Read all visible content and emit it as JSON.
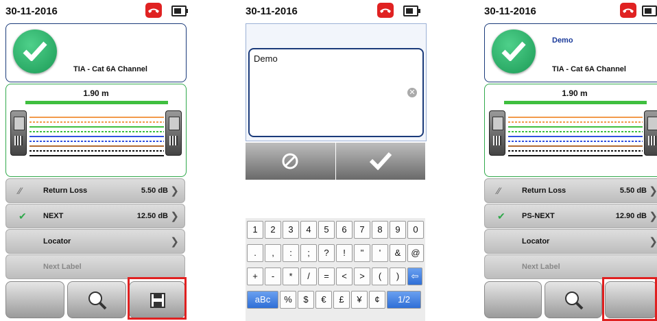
{
  "panel1": {
    "date": "30-11-2016",
    "standard": "TIA - Cat 6A Channel",
    "length": "1.90 m",
    "rows": [
      {
        "name": "Return Loss",
        "value": "5.50 dB"
      },
      {
        "name": "NEXT",
        "value": "12.50 dB"
      },
      {
        "name": "Locator",
        "value": ""
      },
      {
        "name": "Next Label",
        "value": ""
      }
    ]
  },
  "panel2": {
    "date": "30-11-2016",
    "text_value": "Demo",
    "keyboard": {
      "row1": [
        "1",
        "2",
        "3",
        "4",
        "5",
        "6",
        "7",
        "8",
        "9",
        "0"
      ],
      "row2": [
        ".",
        ",",
        ":",
        ";",
        "?",
        "!",
        "\"",
        "'",
        "&",
        "@"
      ],
      "row3": [
        "+",
        "-",
        "*",
        "/",
        "=",
        "<",
        ">",
        "(",
        ")"
      ],
      "row4": [
        "aBc",
        "%",
        "$",
        "€",
        "£",
        "¥",
        "¢",
        "1/2"
      ]
    }
  },
  "panel3": {
    "date": "30-11-2016",
    "label_name": "Demo",
    "standard": "TIA - Cat 6A Channel",
    "length": "1.90 m",
    "rows": [
      {
        "name": "Return Loss",
        "value": "5.50 dB"
      },
      {
        "name": "PS-NEXT",
        "value": "12.90 dB"
      },
      {
        "name": "Locator",
        "value": ""
      },
      {
        "name": "Next Label",
        "value": ""
      }
    ]
  },
  "colors": {
    "pass_green": "#2fa84a",
    "highlight_red": "#e02020",
    "accent_blue": "#1a3a7a"
  },
  "wire_colors": [
    "#f29a4a",
    "#f29a4a",
    "#3fbf3f",
    "#3fbf3f",
    "#3050e0",
    "#3050e0",
    "#b06a30",
    "#111111",
    "#111111"
  ]
}
